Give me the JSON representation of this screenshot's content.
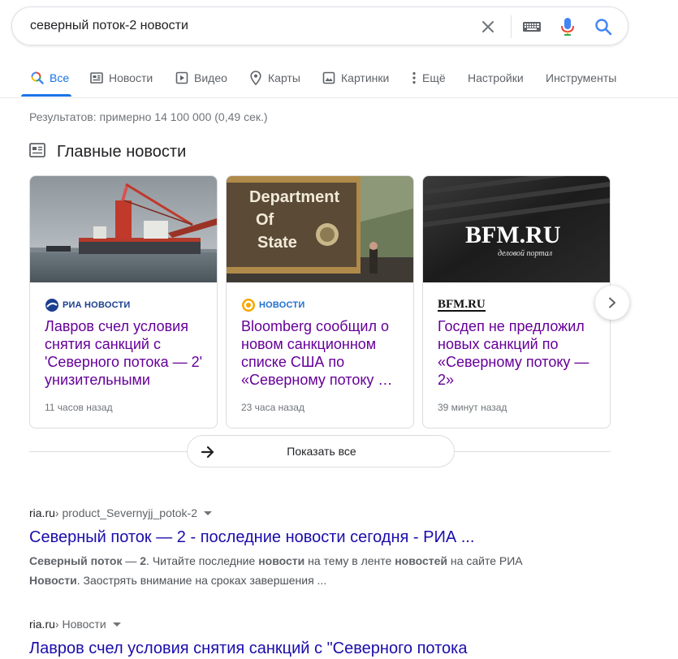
{
  "search": {
    "query": "северный поток-2 новости"
  },
  "tabs": [
    {
      "label": "Все",
      "icon": "search-multicolor-icon",
      "active": true
    },
    {
      "label": "Новости",
      "icon": "newspaper-icon"
    },
    {
      "label": "Видео",
      "icon": "play-icon"
    },
    {
      "label": "Карты",
      "icon": "map-pin-icon"
    },
    {
      "label": "Картинки",
      "icon": "image-icon"
    },
    {
      "label": "Ещё",
      "icon": "more-vertical-icon"
    },
    {
      "label": "Настройки"
    },
    {
      "label": "Инструменты"
    }
  ],
  "stats": "Результатов: примерно 14 100 000 (0,49 сек.)",
  "top_news": {
    "heading": "Главные новости",
    "cards": [
      {
        "source": "РИА НОВОСТИ",
        "title": "Лавров счел условия снятия санкций с 'Северного потока — 2' унизительными",
        "time": "11 часов назад"
      },
      {
        "source": "НОВОСТИ",
        "title": "Bloomberg сообщил о новом санкционном списке США по «Северному потоку …",
        "time": "23 часа назад",
        "image_text": [
          "Department",
          "Of",
          "State"
        ]
      },
      {
        "source": "BFM.RU",
        "title": "Госдеп не предложил новых санкций по «Северному потоку — 2»",
        "time": "39 минут назад",
        "image_text": [
          "BFM.RU",
          "деловой портал"
        ]
      }
    ],
    "show_all": "Показать все"
  },
  "results": [
    {
      "domain": "ria.ru",
      "path": " › product_Severnyjj_potok-2",
      "title": "Северный поток — 2 - последние новости сегодня - РИА ...",
      "snippet": {
        "s1": "Северный поток",
        "s2": " — ",
        "s3": "2",
        "s4": ". Читайте последние ",
        "s5": "новости",
        "s6": " на тему в ленте ",
        "s7": "новостей",
        "s8": " на сайте РИА ",
        "s9": "Новости",
        "s10": ". Заострять внимание на сроках завершения ..."
      }
    },
    {
      "domain": "ria.ru",
      "path": " › Новости",
      "title": "Лавров счел условия снятия санкций с \"Северного потока"
    }
  ],
  "colors": {
    "link": "#1a0dab",
    "visited": "#660099",
    "accent": "#1a73e8"
  }
}
